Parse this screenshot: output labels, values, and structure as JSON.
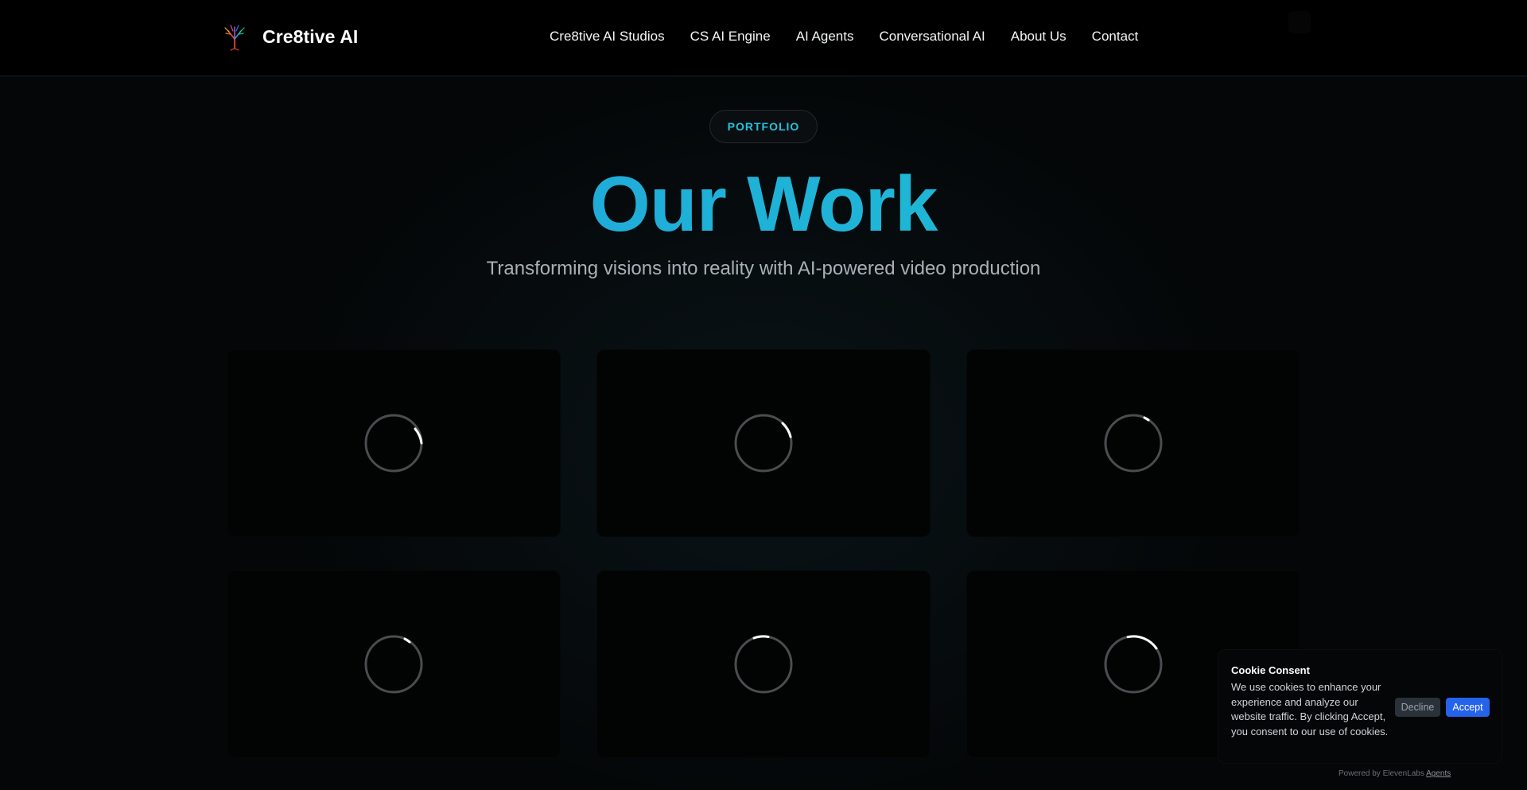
{
  "header": {
    "brand": "Cre8tive AI",
    "nav": [
      "Cre8tive AI Studios",
      "CS AI Engine",
      "AI Agents",
      "Conversational AI",
      "About Us",
      "Contact"
    ]
  },
  "hero": {
    "badge": "PORTFOLIO",
    "title": "Our Work",
    "subtitle": "Transforming visions into reality with AI-powered video production"
  },
  "portfolio": {
    "items": [
      {
        "state": "loading",
        "icon": "loading-spinner-icon"
      },
      {
        "state": "loading",
        "icon": "loading-spinner-icon"
      },
      {
        "state": "loading",
        "icon": "loading-spinner-icon"
      },
      {
        "state": "loading",
        "icon": "loading-spinner-icon"
      },
      {
        "state": "loading",
        "icon": "loading-spinner-icon"
      },
      {
        "state": "loading",
        "icon": "loading-spinner-icon"
      }
    ]
  },
  "cookie": {
    "title": "Cookie Consent",
    "text": "We use cookies to enhance your experience and analyze our website traffic. By clicking Accept, you consent to our use of cookies.",
    "decline": "Decline",
    "accept": "Accept"
  },
  "footer": {
    "powered_prefix": "Powered by ElevenLabs",
    "powered_link": "Agents"
  },
  "colors": {
    "accent_cyan": "#22c4e0",
    "title_gradient_start": "#2a8fe0",
    "title_gradient_end": "#1ec6d2",
    "accept_button": "#2563eb",
    "decline_button": "#2a3138"
  }
}
